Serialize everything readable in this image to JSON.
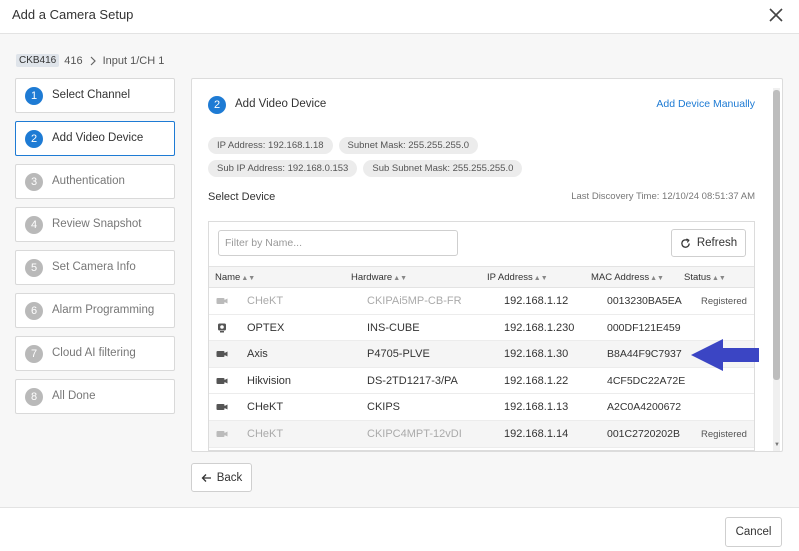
{
  "dialog": {
    "title": "Add a Camera Setup"
  },
  "breadcrumb": {
    "tag": "CKB416",
    "device": "416",
    "input": "Input 1/CH 1"
  },
  "steps": [
    {
      "num": "1",
      "label": "Select Channel",
      "state": "done"
    },
    {
      "num": "2",
      "label": "Add Video Device",
      "state": "active"
    },
    {
      "num": "3",
      "label": "Authentication",
      "state": "pending"
    },
    {
      "num": "4",
      "label": "Review Snapshot",
      "state": "pending"
    },
    {
      "num": "5",
      "label": "Set Camera Info",
      "state": "pending"
    },
    {
      "num": "6",
      "label": "Alarm Programming",
      "state": "pending"
    },
    {
      "num": "7",
      "label": "Cloud AI filtering",
      "state": "pending"
    },
    {
      "num": "8",
      "label": "All Done",
      "state": "pending"
    }
  ],
  "panel": {
    "step_num": "2",
    "title": "Add Video Device",
    "add_manually": "Add Device Manually",
    "chips": [
      "IP Address: 192.168.1.18",
      "Subnet Mask: 255.255.255.0",
      "Sub IP Address: 192.168.0.153",
      "Sub Subnet Mask: 255.255.255.0"
    ],
    "select_label": "Select Device",
    "discovery": "Last Discovery Time: 12/10/24 08:51:37 AM",
    "filter_placeholder": "Filter by Name...",
    "refresh": "Refresh"
  },
  "table": {
    "columns": [
      "Name",
      "Hardware",
      "IP Address",
      "MAC Address",
      "Status"
    ],
    "rows": [
      {
        "name": "CHeKT",
        "hardware": "CKIPAi5MP-CB-FR",
        "ip": "192.168.1.12",
        "mac": "0013230BA5EA",
        "status": "Registered",
        "icon": "camera-icon",
        "dim": true,
        "shaded": false
      },
      {
        "name": "OPTEX",
        "hardware": "INS-CUBE",
        "ip": "192.168.1.230",
        "mac": "000DF121E459",
        "status": "",
        "icon": "cube-camera-icon",
        "dim": false,
        "shaded": false
      },
      {
        "name": "Axis",
        "hardware": "P4705-PLVE",
        "ip": "192.168.1.30",
        "mac": "B8A44F9C7937",
        "status": "",
        "icon": "camera-icon",
        "dim": false,
        "shaded": true
      },
      {
        "name": "Hikvision",
        "hardware": "DS-2TD1217-3/PA",
        "ip": "192.168.1.22",
        "mac": "4CF5DC22A72E",
        "status": "",
        "icon": "camera-icon",
        "dim": false,
        "shaded": false
      },
      {
        "name": "CHeKT",
        "hardware": "CKIPS",
        "ip": "192.168.1.13",
        "mac": "A2C0A4200672",
        "status": "",
        "icon": "camera-icon",
        "dim": false,
        "shaded": false
      },
      {
        "name": "CHeKT",
        "hardware": "CKIPC4MPT-12vDI",
        "ip": "192.168.1.14",
        "mac": "001C2720202B",
        "status": "Registered",
        "icon": "camera-icon",
        "dim": true,
        "shaded": true
      }
    ]
  },
  "buttons": {
    "back": "Back",
    "cancel": "Cancel"
  },
  "colors": {
    "accent": "#1e7bd4",
    "annotation_arrow": "#3b45c4"
  },
  "icons": {
    "close": "close-icon",
    "breadcrumb_separator": "chevron-right-icon",
    "refresh": "refresh-icon",
    "back": "arrow-left-icon",
    "sort": "sort-icon",
    "annotation": "pointer-arrow-icon"
  }
}
